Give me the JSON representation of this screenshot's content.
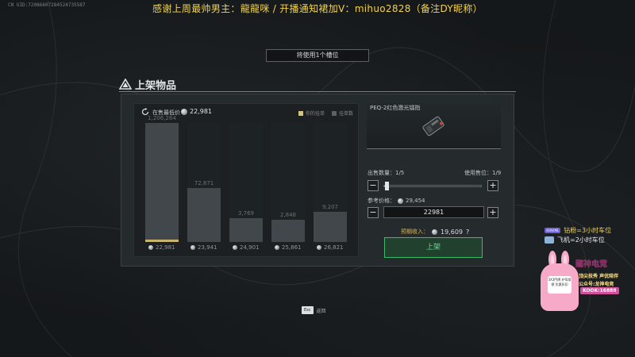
{
  "stream_overlay": {
    "uid": "CN UID:7208660728452473558​7",
    "banner": "感谢上周最帅男主：龍龍咪 / 开播通知裙加V：mihuo2828（备注DY昵称）",
    "side_rows": [
      {
        "tag": "4EN4ML",
        "text": "钻粉=3小时车位",
        "color": "#f0d25a"
      },
      {
        "tag": "",
        "text": "飞机=2小时车位",
        "color": "#e8e8ec"
      }
    ],
    "brand": {
      "title": "龍神电竞",
      "line1": "顶尖技秀 声优陪伴",
      "line2": "公众号:龙神电竞",
      "kook": "KOOK:16888",
      "sign_text": "3X3門牌 护驾保镖 优惠折扣"
    }
  },
  "slot_note": "将使用1个槽位",
  "dialog": {
    "title": "上架物品",
    "lowest_price_label": "在售最低价",
    "lowest_price_value": "22,981",
    "legend_mine": "你的挂单",
    "legend_count": "挂单数",
    "item_name": "PEQ-2红色激光镭指",
    "sell_qty_label": "出售数量：",
    "sell_qty_value": "1/5",
    "use_slot_label": "使用售位：",
    "use_slot_value": "1/9",
    "ref_price_label": "参考价格：",
    "ref_price_value": "29,454",
    "price_input": "22981",
    "income_label": "预期收入：",
    "income_value": "19,609",
    "help": "?",
    "list_button": "上架",
    "minus": "−",
    "plus": "+"
  },
  "esc": {
    "key": "Esc",
    "label": "返回"
  },
  "chart_data": {
    "type": "bar",
    "categories": [
      "22,981",
      "23,941",
      "24,901",
      "25,861",
      "26,821"
    ],
    "values": [
      1206264,
      72871,
      3769,
      2848,
      9207
    ],
    "value_labels": [
      "1,206,264",
      "72,871",
      "3,769",
      "2,848",
      "9,207"
    ],
    "ylim": [
      0,
      1206264
    ],
    "selected_index": 0,
    "colors": {
      "bar": "#484e51",
      "selected": "#c9b46a"
    },
    "legend_placement": "top-right"
  }
}
